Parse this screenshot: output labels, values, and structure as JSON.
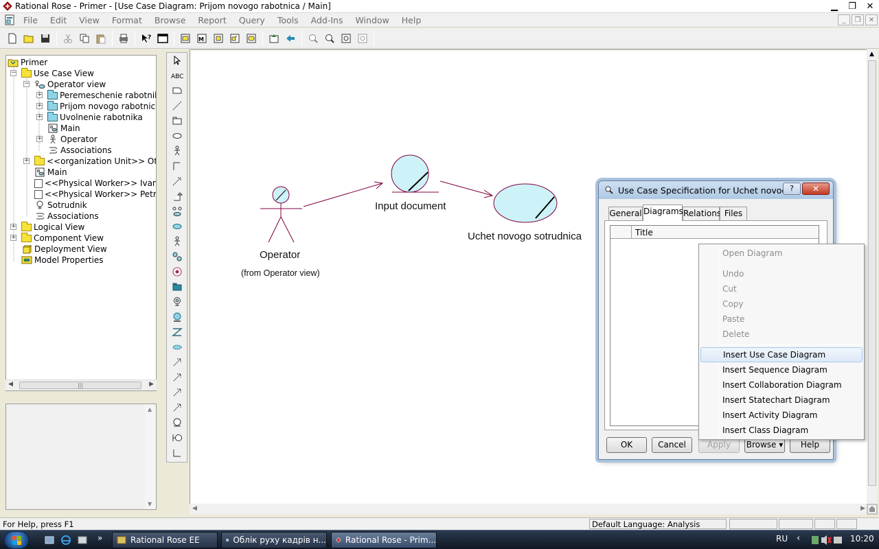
{
  "window": {
    "title": "Rational Rose - Primer - [Use Case Diagram: Prijom novogo rabotnica / Main]",
    "minimize": "▁",
    "restore": "❐",
    "close": "✕"
  },
  "menu": [
    "File",
    "Edit",
    "View",
    "Format",
    "Browse",
    "Report",
    "Query",
    "Tools",
    "Add-Ins",
    "Window",
    "Help"
  ],
  "browser": {
    "items": [
      {
        "label": "Primer"
      },
      {
        "label": "Use Case View"
      },
      {
        "label": "Operator view"
      },
      {
        "label": "Peremeschenie rabotnika"
      },
      {
        "label": "Prijom novogo rabotnica"
      },
      {
        "label": "Uvolnenie rabotnika"
      },
      {
        "label": "Main"
      },
      {
        "label": "Operator"
      },
      {
        "label": "Associations"
      },
      {
        "label": "<<organization Unit>> Otdel kadrov"
      },
      {
        "label": "Main"
      },
      {
        "label": "<<Physical Worker>> Ivanov"
      },
      {
        "label": "<<Physical Worker>> Petrov"
      },
      {
        "label": "Sotrudnik"
      },
      {
        "label": "Associations"
      },
      {
        "label": "Logical View"
      },
      {
        "label": "Component View"
      },
      {
        "label": "Deployment View"
      },
      {
        "label": "Model Properties"
      }
    ]
  },
  "diagram": {
    "actor_label": "Operator",
    "actor_sub": "(from Operator view)",
    "boundary_label": "Input document",
    "usecase_label": "Uchet novogo sotrudnica",
    "stroke_color": "#800040",
    "fill_color": "#cdf2f7"
  },
  "dialog": {
    "title": "Use Case Specification for Uchet novogo s...",
    "help_glyph": "?",
    "close_glyph": "✕",
    "tabs": [
      "General",
      "Diagrams",
      "Relations",
      "Files"
    ],
    "column_title": "Title",
    "buttons": {
      "ok": "OK",
      "cancel": "Cancel",
      "apply": "Apply",
      "browse": "Browse ▾",
      "help": "Help"
    }
  },
  "context_menu": {
    "items_disabled": [
      "Open Diagram",
      "Undo",
      "Cut",
      "Copy",
      "Paste",
      "Delete"
    ],
    "items_enabled": [
      "Insert Use Case Diagram",
      "Insert Sequence Diagram",
      "Insert Collaboration Diagram",
      "Insert Statechart Diagram",
      "Insert Activity Diagram",
      "Insert Class Diagram"
    ]
  },
  "status": {
    "help": "For Help, press F1",
    "language": "Default Language: Analysis"
  },
  "taskbar": {
    "tasks": [
      "Rational Rose EE",
      "Облік руху кадрів н...",
      "Rational Rose - Prim..."
    ],
    "lang": "RU",
    "clock": "10:20"
  }
}
